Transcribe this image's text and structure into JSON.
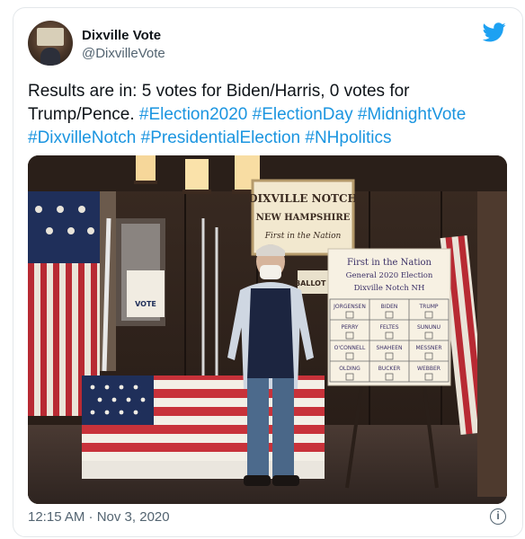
{
  "account": {
    "name": "Dixville Vote",
    "handle": "@DixvilleVote",
    "avatar_icon": "person-at-ballot-box-avatar",
    "brand_icon": "twitter-bird-icon"
  },
  "tweet": {
    "text": "Results are in: 5 votes for Biden/Harris, 0 votes for Trump/Pence.",
    "hashtags": [
      "#Election2020",
      "#ElectionDay",
      "#MidnightVote",
      "#DixvilleNotch",
      "#PresidentialElection",
      "#NHpolitics"
    ],
    "timestamp": "12:15 AM · Nov 3, 2020",
    "info_icon": "info-icon"
  },
  "photo": {
    "wall_sign": {
      "line1": "DIXVILLE NOTCH",
      "line2": "NEW HAMPSHIRE",
      "line3": "First in the Nation"
    },
    "poster": {
      "sign": "VOTE",
      "sub": "BALLOT BOX"
    },
    "board": {
      "title1": "First in the Nation",
      "title2": "General 2020 Election",
      "title3": "Dixville Notch NH",
      "rows": [
        [
          "JORGENSEN",
          "BIDEN",
          "TRUMP"
        ],
        [
          "PERRY",
          "FELTES",
          "SUNUNU"
        ],
        [
          "O'CONNELL",
          "SHAHEEN",
          "MESSNER"
        ],
        [
          "OLDING",
          "BUCKER",
          "WEBBER"
        ]
      ],
      "marks": [
        [
          "",
          "",
          ""
        ],
        [
          "",
          "",
          ""
        ],
        [
          "",
          "",
          ""
        ],
        [
          "",
          "",
          ""
        ]
      ]
    }
  },
  "colors": {
    "link": "#1b95e0",
    "twitter_blue": "#1da1f2",
    "text": "#0f1419",
    "muted": "#536471"
  }
}
